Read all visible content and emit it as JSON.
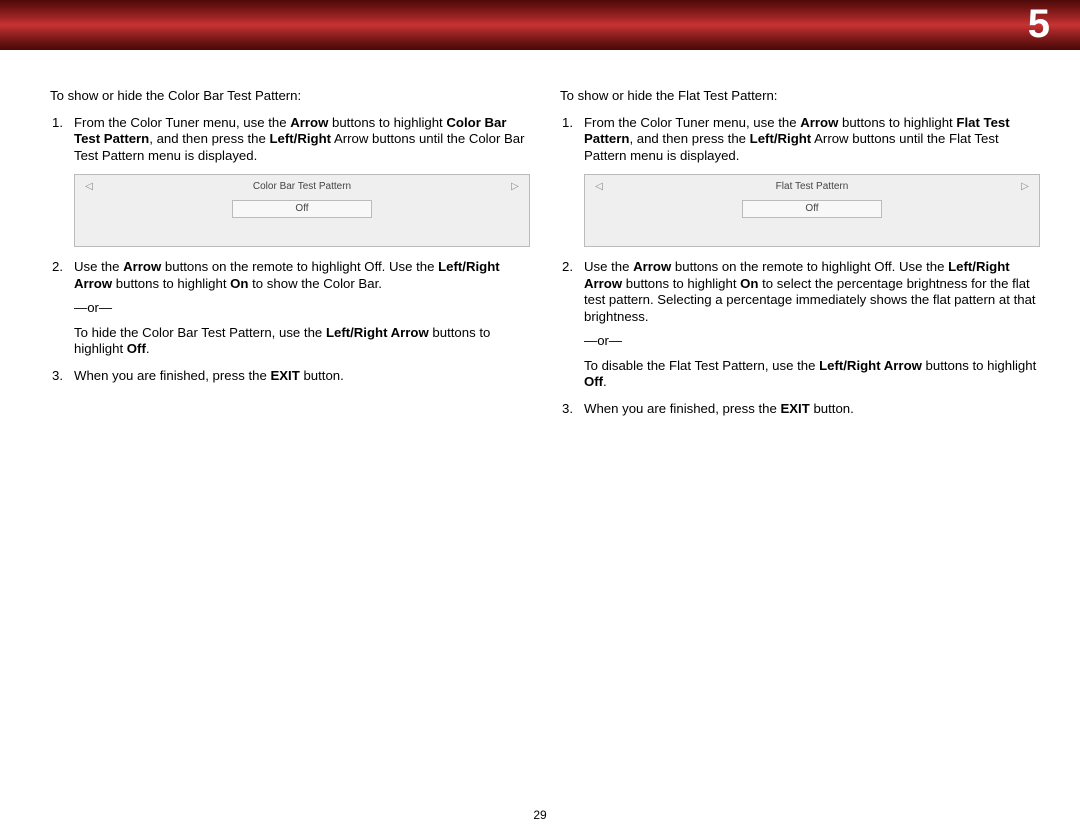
{
  "chapter": "5",
  "pageNumber": "29",
  "left": {
    "intro": "To show or hide the Color Bar Test Pattern:",
    "step1_a": "From the Color Tuner menu, use the ",
    "step1_b": "Arrow",
    "step1_c": " buttons to highlight ",
    "step1_d": "Color Bar Test Pattern",
    "step1_e": ", and then press the ",
    "step1_f": "Left/Right",
    "step1_g": " Arrow buttons until the Color Bar Test Pattern menu is displayed.",
    "menuTitle": "Color Bar Test Pattern",
    "menuValue": "Off",
    "step2_a": "Use the ",
    "step2_b": "Arrow",
    "step2_c": " buttons on the remote to highlight Off. Use the ",
    "step2_d": "Left/Right Arrow",
    "step2_e": " buttons to highlight ",
    "step2_f": "On",
    "step2_g": " to show the Color Bar.",
    "or": "—or—",
    "hide_a": "To hide the Color Bar Test Pattern, use the ",
    "hide_b": "Left/Right Arrow",
    "hide_c": " buttons to highlight ",
    "hide_d": "Off",
    "hide_e": ".",
    "step3_a": "When you are finished, press the ",
    "step3_b": "EXIT",
    "step3_c": " button."
  },
  "right": {
    "intro": "To show or hide the Flat Test Pattern:",
    "step1_a": "From the Color Tuner menu, use the ",
    "step1_b": "Arrow",
    "step1_c": " buttons to highlight ",
    "step1_d": "Flat Test Pattern",
    "step1_e": ", and then press the ",
    "step1_f": "Left/Right",
    "step1_g": " Arrow buttons until the Flat Test Pattern menu is displayed.",
    "menuTitle": "Flat Test Pattern",
    "menuValue": "Off",
    "step2_a": "Use the ",
    "step2_b": "Arrow",
    "step2_c": " buttons on the remote to highlight Off. Use the ",
    "step2_d": "Left/Right Arrow",
    "step2_e": " buttons to highlight ",
    "step2_f": "On",
    "step2_g": " to select the percentage brightness for the flat test pattern. Selecting a percentage immediately shows the flat pattern at that brightness.",
    "or": "—or—",
    "hide_a": "To disable the Flat Test Pattern, use the ",
    "hide_b": "Left/Right Arrow",
    "hide_c": " buttons to highlight ",
    "hide_d": "Off",
    "hide_e": ".",
    "step3_a": "When you are finished, press the ",
    "step3_b": "EXIT",
    "step3_c": " button."
  }
}
